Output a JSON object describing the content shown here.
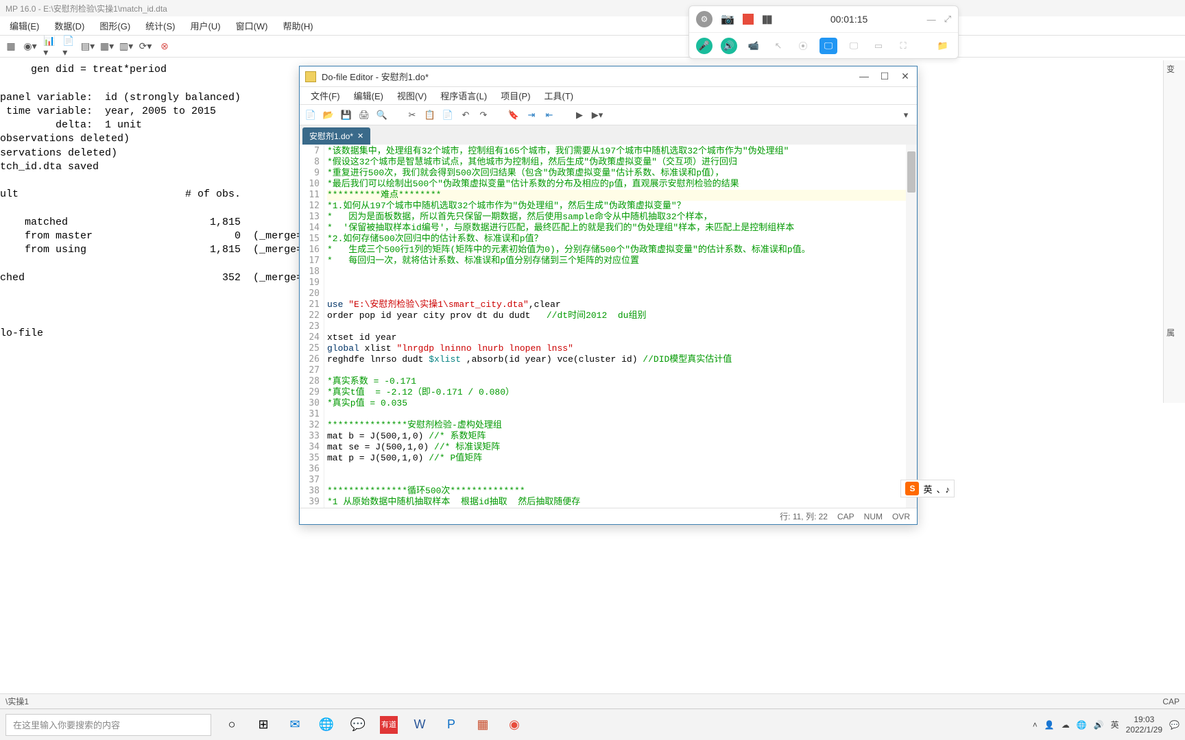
{
  "titlebar": "MP 16.0 - E:\\安慰剂检验\\实操1\\match_id.dta",
  "main_menu": [
    "编辑(E)",
    "数据(D)",
    "图形(G)",
    "统计(S)",
    "用户(U)",
    "窗口(W)",
    "帮助(H)"
  ],
  "results_text": "     gen did = treat*period\n\npanel variable:  id (strongly balanced)\n time variable:  year, 2005 to 2015\n         delta:  1 unit\nobservations deleted)\nservations deleted)\ntch_id.dta saved\n\nult                           # of obs.\n\n    matched                       1,815\n    from master                       0  (_merge==1\n    from using                    1,815  (_merge==2\n\nched                                352  (_merge==3\n\n\n\nlo-file\n",
  "doedit": {
    "title": "Do-file Editor - 安慰剂1.do*",
    "menu": [
      "文件(F)",
      "编辑(E)",
      "视图(V)",
      "程序语言(L)",
      "项目(P)",
      "工具(T)"
    ],
    "tab": "安慰剂1.do*",
    "status": {
      "pos": "行: 11, 列: 22",
      "cap": "CAP",
      "num": "NUM",
      "ovr": "OVR"
    }
  },
  "code_lines": [
    {
      "n": 7,
      "cls": "c-green",
      "t": "*该数据集中，处理组有32个城市，控制组有165个城市，我们需要从197个城市中随机选取32个城市作为\"伪处理组\""
    },
    {
      "n": 8,
      "cls": "c-green",
      "t": "*假设这32个城市是智慧城市试点，其他城市为控制组，然后生成\"伪政策虚拟变量\"（交互项）进行回归"
    },
    {
      "n": 9,
      "cls": "c-green",
      "t": "*重复进行500次，我们就会得到500次回归结果（包含\"伪政策虚拟变量\"估计系数、标准误和p值），"
    },
    {
      "n": 10,
      "cls": "c-green",
      "t": "*最后我们可以绘制出500个\"伪政策虚拟变量\"估计系数的分布及相应的p值，直观展示安慰剂检验的结果"
    },
    {
      "n": 11,
      "cls": "c-green hl",
      "t": "**********难点********"
    },
    {
      "n": 12,
      "cls": "c-green",
      "t": "*1.如何从197个城市中随机选取32个城市作为\"伪处理组\"，然后生成\"伪政策虚拟变量\"？"
    },
    {
      "n": 13,
      "cls": "c-green",
      "t": "*   因为是面板数据，所以首先只保留一期数据，然后使用sample命令从中随机抽取32个样本，"
    },
    {
      "n": 14,
      "cls": "c-green",
      "t": "*  '保留被抽取样本id编号'，与原数据进行匹配，最终匹配上的就是我们的\"伪处理组\"样本，未匹配上是控制组样本"
    },
    {
      "n": 15,
      "cls": "c-green",
      "t": "*2.如何存储500次回归中的估计系数、标准误和p值？"
    },
    {
      "n": 16,
      "cls": "c-green",
      "t": "*   生成三个500行1列的矩阵(矩阵中的元素初始值为0)，分别存储500个\"伪政策虚拟变量\"的估计系数、标准误和p值。"
    },
    {
      "n": 17,
      "cls": "c-green",
      "t": "*   每回归一次，就将估计系数、标准误和p值分别存储到三个矩阵的对应位置"
    },
    {
      "n": 18,
      "cls": "",
      "t": ""
    },
    {
      "n": 19,
      "cls": "",
      "t": ""
    },
    {
      "n": 20,
      "cls": "",
      "t": ""
    },
    {
      "n": 21,
      "cls": "mix",
      "t": "<span class='c-navy'>use</span> <span class='c-red'>\"E:\\安慰剂检验\\实操1\\smart_city.dta\"</span><span class='c-black'>,clear</span>"
    },
    {
      "n": 22,
      "cls": "mix",
      "t": "<span class='c-black'>order pop id year city prov dt du dudt   </span><span class='c-green'>//dt时间2012  du组别</span>"
    },
    {
      "n": 23,
      "cls": "",
      "t": ""
    },
    {
      "n": 24,
      "cls": "c-black",
      "t": "xtset id year"
    },
    {
      "n": 25,
      "cls": "mix",
      "t": "<span class='c-navy'>global</span> <span class='c-black'>xlist </span><span class='c-red'>\"lnrgdp lninno lnurb lnopen lnss\"</span>"
    },
    {
      "n": 26,
      "cls": "mix",
      "t": "<span class='c-black'>reghdfe lnrso dudt </span><span class='c-teal'>$xlist</span><span class='c-black'> ,absorb(id year) vce(cluster id) </span><span class='c-green'>//DID模型真实估计值</span>"
    },
    {
      "n": 27,
      "cls": "",
      "t": ""
    },
    {
      "n": 28,
      "cls": "c-green",
      "t": "*真实系数 = -0.171"
    },
    {
      "n": 29,
      "cls": "c-green",
      "t": "*真实t值  = -2.12（即-0.171 / 0.080）"
    },
    {
      "n": 30,
      "cls": "c-green",
      "t": "*真实p值 = 0.035"
    },
    {
      "n": 31,
      "cls": "",
      "t": ""
    },
    {
      "n": 32,
      "cls": "c-green",
      "t": "***************安慰剂检验-虚构处理组"
    },
    {
      "n": 33,
      "cls": "mix",
      "t": "<span class='c-black'>mat b = J(500,1,0) </span><span class='c-green'>//* 系数矩阵</span>"
    },
    {
      "n": 34,
      "cls": "mix",
      "t": "<span class='c-black'>mat se = J(500,1,0) </span><span class='c-green'>//* 标准误矩阵</span>"
    },
    {
      "n": 35,
      "cls": "mix",
      "t": "<span class='c-black'>mat p = J(500,1,0) </span><span class='c-green'>//* P值矩阵</span>"
    },
    {
      "n": 36,
      "cls": "",
      "t": ""
    },
    {
      "n": 37,
      "cls": "",
      "t": ""
    },
    {
      "n": 38,
      "cls": "c-green",
      "t": "***************循环500次**************"
    },
    {
      "n": 39,
      "cls": "c-green",
      "t": "*1 从原始数据中随机抽取样本  根据id抽取  然后抽取随便存"
    }
  ],
  "recorder": {
    "time": "00:01:15"
  },
  "statusbar": {
    "left": "\\实操1",
    "right": "CAP"
  },
  "taskbar": {
    "search_placeholder": "在这里输入你要搜索的内容",
    "time": "19:03",
    "date": "2022/1/29"
  },
  "ime": {
    "label": "英",
    "icons": "、♪"
  },
  "rightpanel_labels": [
    "变",
    "属"
  ]
}
